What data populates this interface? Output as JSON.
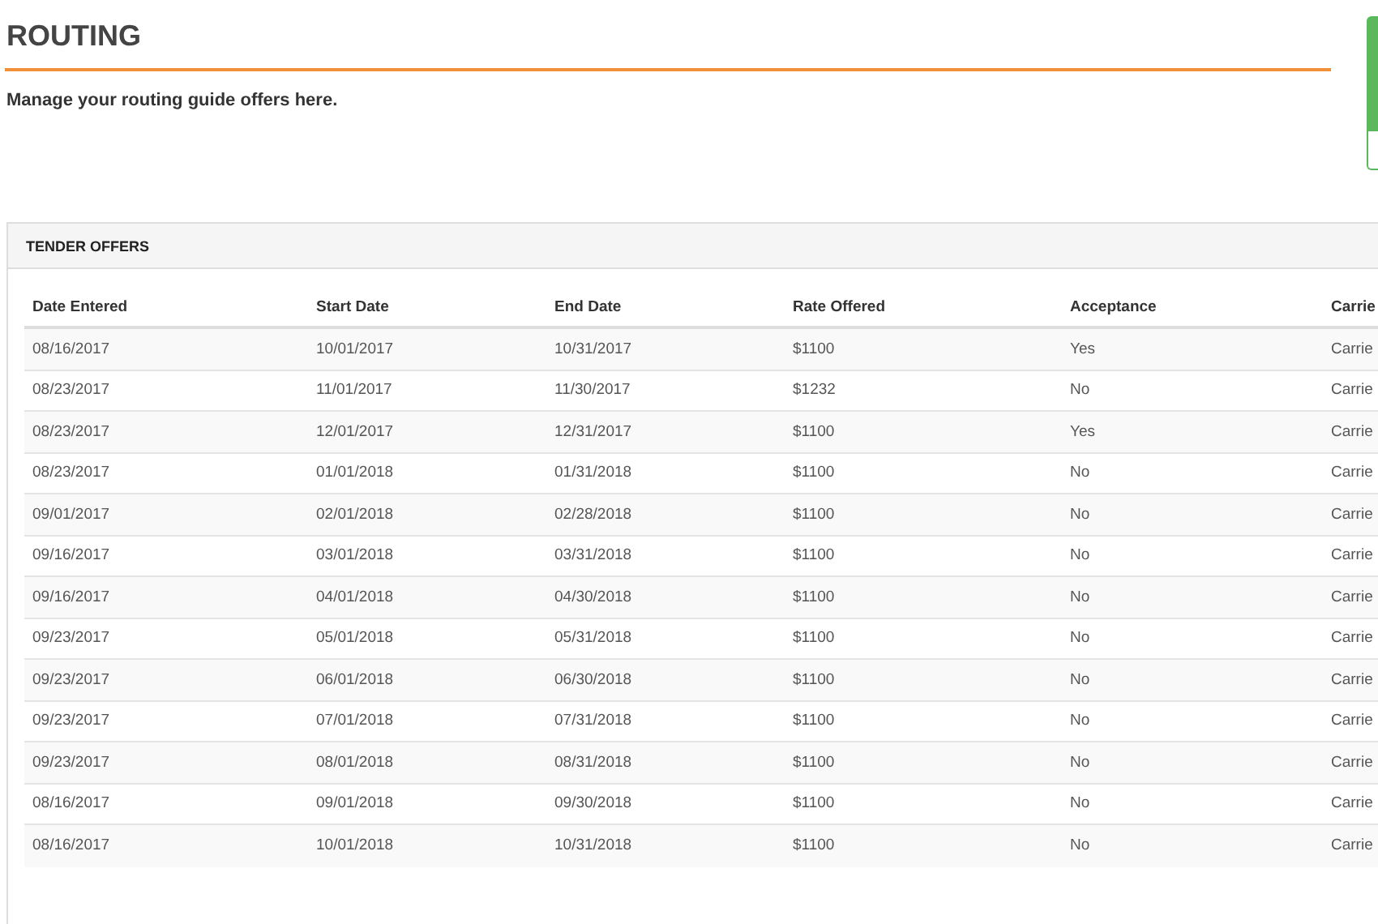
{
  "page": {
    "title": "ROUTING",
    "subtitle": "Manage your routing guide offers here."
  },
  "panel": {
    "title": "TENDER OFFERS"
  },
  "table": {
    "columns": [
      "Date Entered",
      "Start Date",
      "End Date",
      "Rate Offered",
      "Acceptance",
      "Carrie"
    ],
    "rows": [
      [
        "08/16/2017",
        "10/01/2017",
        "10/31/2017",
        "$1100",
        "Yes",
        "Carrie"
      ],
      [
        "08/23/2017",
        "11/01/2017",
        "11/30/2017",
        "$1232",
        "No",
        "Carrie"
      ],
      [
        "08/23/2017",
        "12/01/2017",
        "12/31/2017",
        "$1100",
        "Yes",
        "Carrie"
      ],
      [
        "08/23/2017",
        "01/01/2018",
        "01/31/2018",
        "$1100",
        "No",
        "Carrie"
      ],
      [
        "09/01/2017",
        "02/01/2018",
        "02/28/2018",
        "$1100",
        "No",
        "Carrie"
      ],
      [
        "09/16/2017",
        "03/01/2018",
        "03/31/2018",
        "$1100",
        "No",
        "Carrie"
      ],
      [
        "09/16/2017",
        "04/01/2018",
        "04/30/2018",
        "$1100",
        "No",
        "Carrie"
      ],
      [
        "09/23/2017",
        "05/01/2018",
        "05/31/2018",
        "$1100",
        "No",
        "Carrie"
      ],
      [
        "09/23/2017",
        "06/01/2018",
        "06/30/2018",
        "$1100",
        "No",
        "Carrie"
      ],
      [
        "09/23/2017",
        "07/01/2018",
        "07/31/2018",
        "$1100",
        "No",
        "Carrie"
      ],
      [
        "09/23/2017",
        "08/01/2018",
        "08/31/2018",
        "$1100",
        "No",
        "Carrie"
      ],
      [
        "08/16/2017",
        "09/01/2018",
        "09/30/2018",
        "$1100",
        "No",
        "Carrie"
      ],
      [
        "08/16/2017",
        "10/01/2018",
        "10/31/2018",
        "$1100",
        "No",
        "Carrie"
      ]
    ]
  }
}
